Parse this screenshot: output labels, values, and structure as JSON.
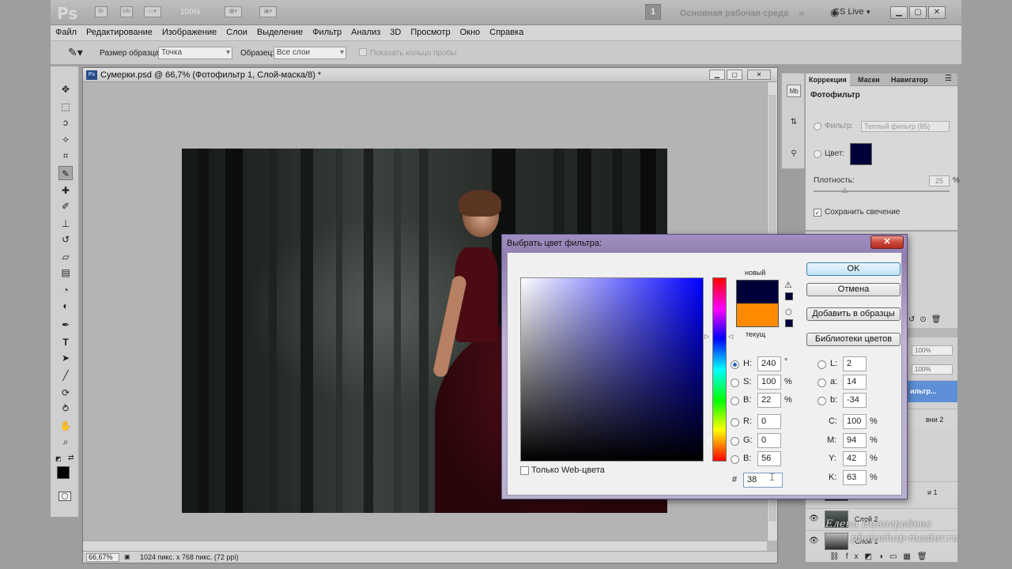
{
  "appbar": {
    "logo": "Ps",
    "icon_br": "Br",
    "icon_mb": "Mb",
    "zoom": "100%",
    "workspace_number": "1",
    "workspace_label": "Основная рабочая среда",
    "cs_live": "CS Live",
    "more": "»"
  },
  "menu": [
    "Файл",
    "Редактирование",
    "Изображение",
    "Слои",
    "Выделение",
    "Фильтр",
    "Анализ",
    "3D",
    "Просмотр",
    "Окно",
    "Справка"
  ],
  "options": {
    "sample_size_label": "Размер образца:",
    "sample_size_value": "Точка",
    "sample_label": "Образец:",
    "sample_value": "Все слои",
    "show_ring_label": "Показать кольцо пробы"
  },
  "document": {
    "title": "Сумерки.psd @ 66,7% (Фотофильтр 1, Слой-маска/8) *",
    "ps_badge": "Ps",
    "zoom": "66,67%",
    "info": "1024 пикс. x 768 пикс. (72 ppi)"
  },
  "adjust_panel": {
    "tabs": [
      "Коррекция",
      "Маски",
      "Навигатор"
    ],
    "title": "Фотофильтр",
    "filter_label": "Фильтр:",
    "filter_value": "Теплый фильтр (85)",
    "color_label": "Цвет:",
    "density_label": "Плотность:",
    "density_value": "25",
    "density_unit": "%",
    "preserve_label": "Сохранить свечение",
    "swatch_color": "#000038"
  },
  "layers_panel": {
    "opacity": "100%",
    "fill": "100%",
    "row_partial_1": "ильтр...",
    "row_partial_2": "вни 2",
    "row_partial_3": "и 1",
    "layer_2": "Слой 2",
    "layer_bg": "Слой 1"
  },
  "dialog": {
    "title": "Выбрать цвет фильтра:",
    "close": "✕",
    "new_label": "новый",
    "current_label": "текущ",
    "ok": "OK",
    "cancel": "Отмена",
    "add_swatch": "Добавить в образцы",
    "libraries": "Библиотеки цветов",
    "web_only": "Только Web-цвета",
    "new_color": "#000038",
    "current_color": "#ff8a00",
    "hsb": [
      {
        "label": "H:",
        "value": "240",
        "unit": "°"
      },
      {
        "label": "S:",
        "value": "100",
        "unit": "%"
      },
      {
        "label": "B:",
        "value": "22",
        "unit": "%"
      }
    ],
    "rgb": [
      {
        "label": "R:",
        "value": "0"
      },
      {
        "label": "G:",
        "value": "0"
      },
      {
        "label": "B:",
        "value": "56"
      }
    ],
    "lab": [
      {
        "label": "L:",
        "value": "2"
      },
      {
        "label": "a:",
        "value": "14"
      },
      {
        "label": "b:",
        "value": "-34"
      }
    ],
    "cmyk": [
      {
        "label": "C:",
        "value": "100",
        "unit": "%"
      },
      {
        "label": "M:",
        "value": "94",
        "unit": "%"
      },
      {
        "label": "Y:",
        "value": "42",
        "unit": "%"
      },
      {
        "label": "K:",
        "value": "63",
        "unit": "%"
      }
    ],
    "hex_label": "#",
    "hex_value": "38"
  },
  "watermark": {
    "line1": "Елена Виноградова",
    "line2": "photoshop-master.ru"
  }
}
